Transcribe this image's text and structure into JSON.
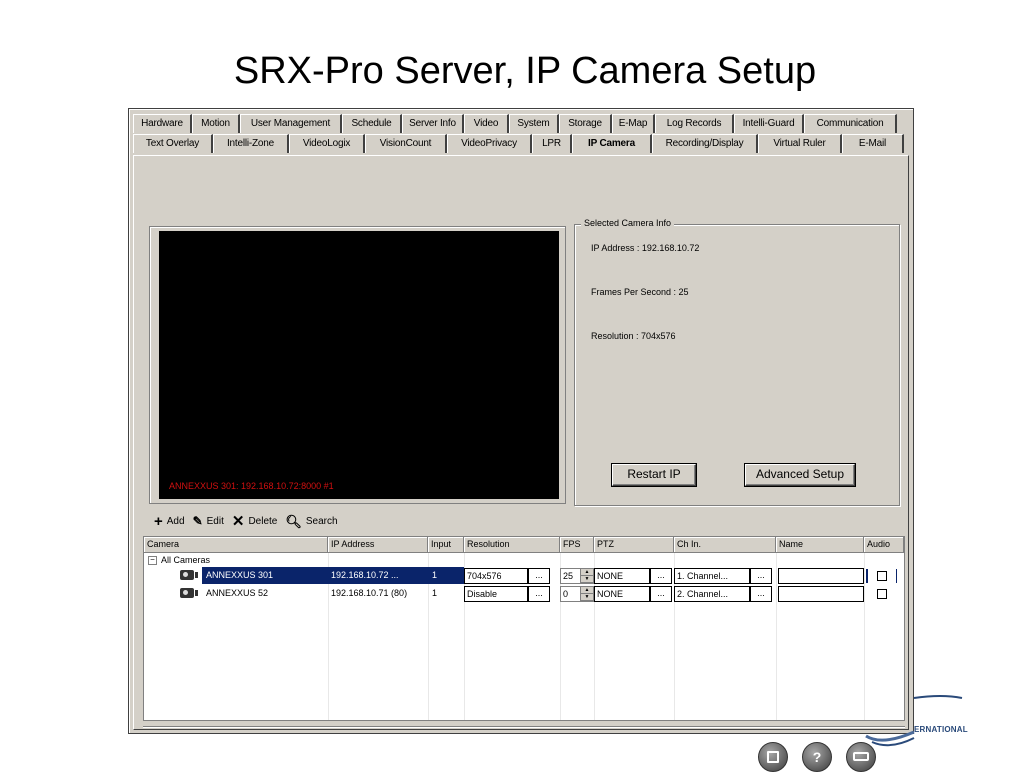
{
  "slide": {
    "title": "SRX-Pro Server, IP Camera Setup"
  },
  "tabs_row1": [
    "Hardware",
    "Motion",
    "User Management",
    "Schedule",
    "Server Info",
    "Video",
    "System",
    "Storage",
    "E-Map",
    "Log Records",
    "Intelli-Guard",
    "Communication"
  ],
  "tabs_row2": [
    "Text Overlay",
    "Intelli-Zone",
    "VideoLogix",
    "VisionCount",
    "VideoPrivacy",
    "LPR",
    "IP Camera",
    "Recording/Display",
    "Virtual Ruler",
    "E-Mail"
  ],
  "video": {
    "overlay_text": "ANNEXXUS 301: 192.168.10.72:8000 #1"
  },
  "camera_info": {
    "legend": "Selected Camera Info",
    "ip_address": "IP Address : 192.168.10.72",
    "fps": "Frames Per Second : 25",
    "resolution": "Resolution : 704x576",
    "restart_button": "Restart IP",
    "advanced_button": "Advanced Setup"
  },
  "toolbar": {
    "add": "Add",
    "edit": "Edit",
    "delete": "Delete",
    "search": "Search"
  },
  "grid": {
    "headers": [
      "Camera",
      "IP Address",
      "Input",
      "Resolution",
      "FPS",
      "PTZ",
      "Ch In.",
      "Name",
      "Audio"
    ],
    "root": "All Cameras",
    "rows": [
      {
        "camera": "ANNEXXUS 301",
        "ip": "192.168.10.72 ...",
        "input": "1",
        "resolution": "704x576",
        "fps": "25",
        "ptz": "NONE",
        "chin": "1. Channel...",
        "name": "",
        "ellipsis": "..."
      },
      {
        "camera": "ANNEXXUS 52",
        "ip": "192.168.10.71 (80)",
        "input": "1",
        "resolution": "Disable",
        "fps": "0",
        "ptz": "NONE",
        "chin": "2. Channel...",
        "name": "",
        "ellipsis": "..."
      }
    ]
  },
  "bottom": {
    "help_glyph": "?"
  },
  "logo": {
    "text": "ERNATIONAL"
  },
  "colors": {
    "window_bg": "#d4d0c8",
    "selection": "#0a246a",
    "overlay_red": "#d01010"
  }
}
